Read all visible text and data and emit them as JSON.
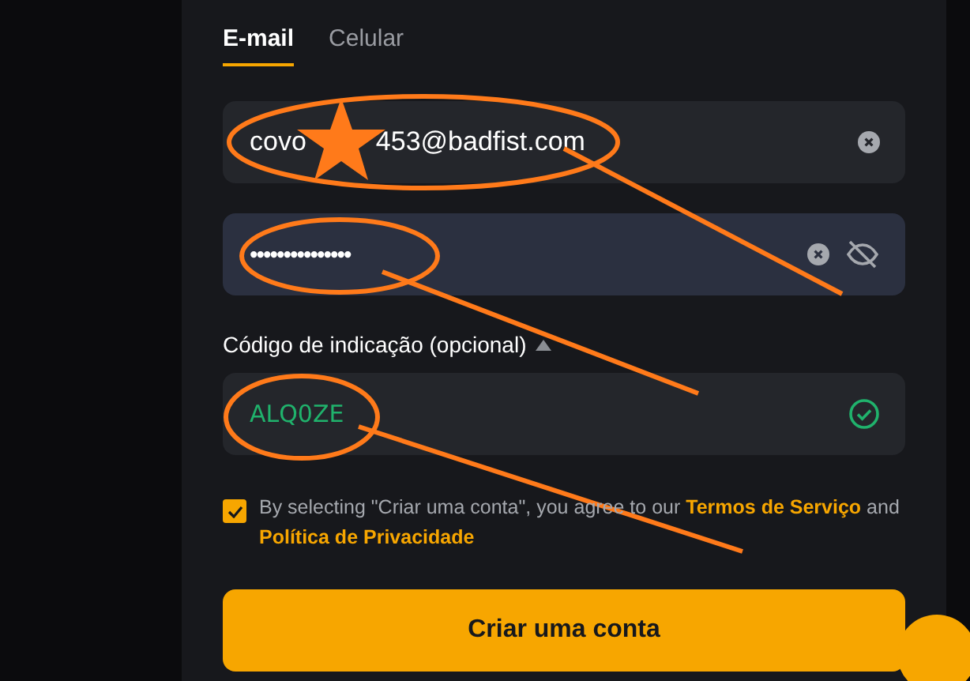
{
  "tabs": [
    {
      "label": "E-mail",
      "selected": true
    },
    {
      "label": "Celular",
      "selected": false
    }
  ],
  "email_field": {
    "value_start": "covo",
    "value_end": "453@badfist.com"
  },
  "password_field": {
    "value": "•••••••••••••••",
    "focused": true
  },
  "referral": {
    "label": "Código de indicação (opcional)",
    "expanded": true,
    "value": "ALQ0ZE",
    "valid": true
  },
  "terms": {
    "checked": true,
    "text_before": "By selecting \"Criar uma conta\", you agree to our",
    "link_1": "Termos de Serviço",
    "text_middle": "and",
    "link_2": "Política de Privacidade"
  },
  "submit_button": "Criar uma conta"
}
